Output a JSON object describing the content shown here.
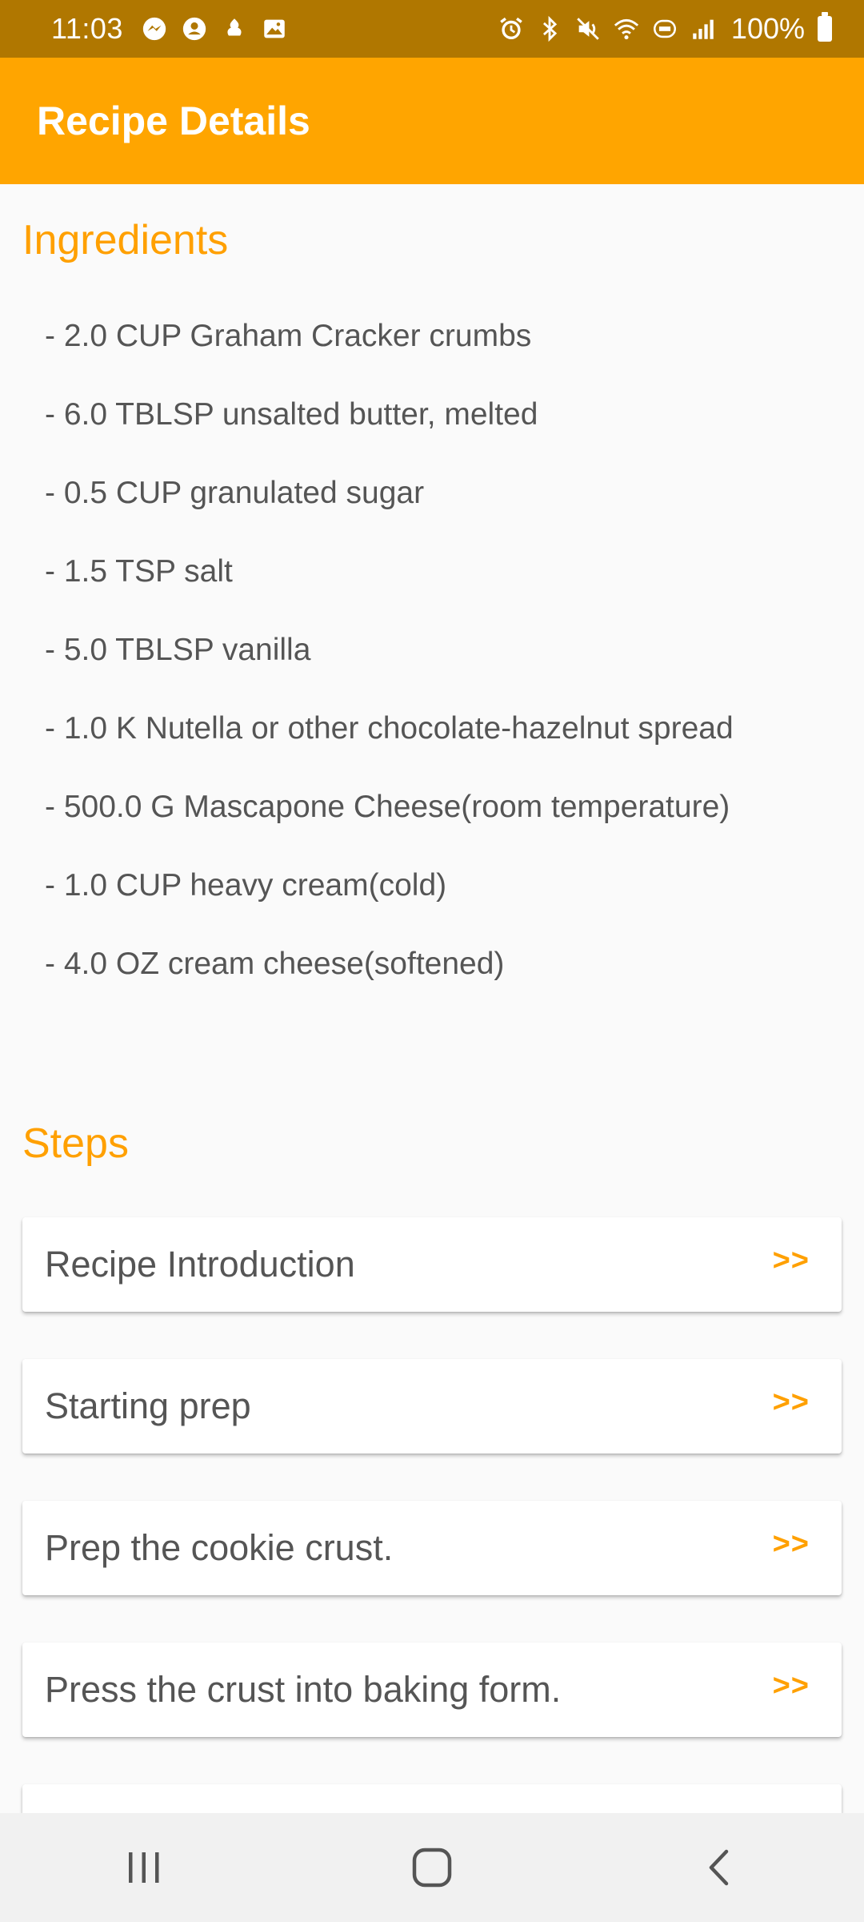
{
  "status_bar": {
    "time": "11:03",
    "battery": "100%",
    "left_icons": [
      "messenger-icon",
      "account-icon",
      "notification-icon",
      "gallery-icon"
    ],
    "right_icons": [
      "alarm-icon",
      "bluetooth-icon",
      "mute-icon",
      "wifi-icon",
      "volte-icon",
      "signal-icon"
    ]
  },
  "app_bar": {
    "title": "Recipe Details",
    "color": "#FFA500"
  },
  "ingredients": {
    "title": "Ingredients",
    "items": [
      "- 2.0 CUP Graham Cracker crumbs",
      "- 6.0 TBLSP unsalted butter, melted",
      "- 0.5 CUP granulated sugar",
      "- 1.5 TSP salt",
      "- 5.0 TBLSP vanilla",
      "- 1.0 K Nutella or other chocolate-hazelnut spread",
      "- 500.0 G Mascapone Cheese(room temperature)",
      "- 1.0 CUP heavy cream(cold)",
      "- 4.0 OZ cream cheese(softened)"
    ]
  },
  "steps": {
    "title": "Steps",
    "arrow": ">>",
    "items": [
      "Recipe Introduction",
      "Starting prep",
      "Prep the cookie crust.",
      "Press the crust into baking form."
    ]
  },
  "nav_bar": {
    "buttons": [
      "recent-apps-icon",
      "home-icon",
      "back-icon"
    ]
  }
}
